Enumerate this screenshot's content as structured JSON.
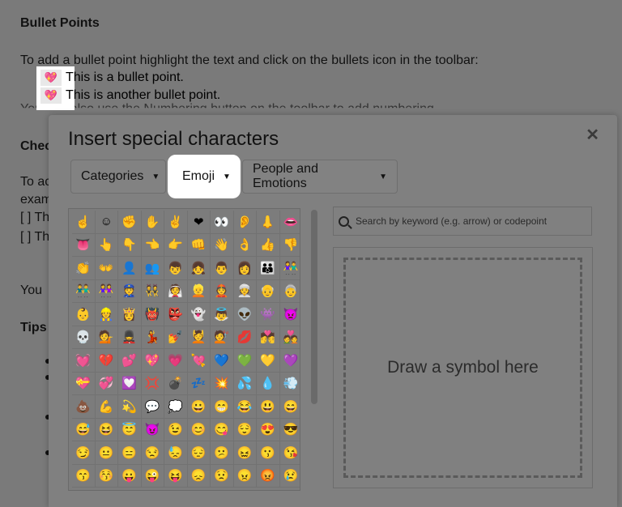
{
  "doc": {
    "heading_bullets": "Bullet Points",
    "intro": "To add a bullet point highlight the text and click on the bullets icon in the toolbar:",
    "bullet_1": "This is a bullet point.",
    "bullet_2": "This is another bullet point.",
    "partial_line": "You can also use the Numbering button on the toolbar to add numbering",
    "heading_checklist": "Chec",
    "line_to_add": "To ac",
    "line_exam": "exam",
    "check_1": "[ ] Th",
    "check_2": "[ ] Th",
    "line_you": "You",
    "heading_tips": "Tips",
    "bullet_icon": "💖"
  },
  "dialog": {
    "title": "Insert special characters",
    "close": "✕",
    "categories_label": "Categories",
    "type_label": "Emoji",
    "subcategory_label": "People and Emotions",
    "caret": "▼",
    "search_placeholder": "Search by keyword (e.g. arrow) or codepoint",
    "draw_label": "Draw a symbol here",
    "emoji": [
      "☝",
      "☺",
      "✊",
      "✋",
      "✌",
      "❤",
      "👀",
      "👂",
      "👃",
      "👄",
      "👅",
      "👆",
      "👇",
      "👈",
      "👉",
      "👊",
      "👋",
      "👌",
      "👍",
      "👎",
      "👏",
      "👐",
      "👤",
      "👥",
      "👦",
      "👧",
      "👨",
      "👩",
      "👪",
      "👫",
      "👬",
      "👭",
      "👮",
      "👯",
      "👰",
      "👱",
      "👲",
      "👳",
      "👴",
      "👵",
      "👶",
      "👷",
      "👸",
      "👹",
      "👺",
      "👻",
      "👼",
      "👽",
      "👾",
      "👿",
      "💀",
      "💁",
      "💂",
      "💃",
      "💅",
      "💆",
      "💇",
      "💋",
      "💏",
      "💑",
      "💓",
      "💔",
      "💕",
      "💖",
      "💗",
      "💘",
      "💙",
      "💚",
      "💛",
      "💜",
      "💝",
      "💞",
      "💟",
      "💢",
      "💣",
      "💤",
      "💥",
      "💦",
      "💧",
      "💨",
      "💩",
      "💪",
      "💫",
      "💬",
      "💭",
      "😀",
      "😁",
      "😂",
      "😃",
      "😄",
      "😅",
      "😆",
      "😇",
      "😈",
      "😉",
      "😊",
      "😋",
      "😌",
      "😍",
      "😎",
      "😏",
      "😐",
      "😑",
      "😒",
      "😓",
      "😔",
      "😕",
      "😖",
      "😗",
      "😘",
      "😙",
      "😚",
      "😛",
      "😜",
      "😝",
      "😞",
      "😟",
      "😠",
      "😡",
      "😢"
    ]
  },
  "colors": {
    "overlay": "#7a7a7a",
    "highlight": "#ffffff"
  }
}
